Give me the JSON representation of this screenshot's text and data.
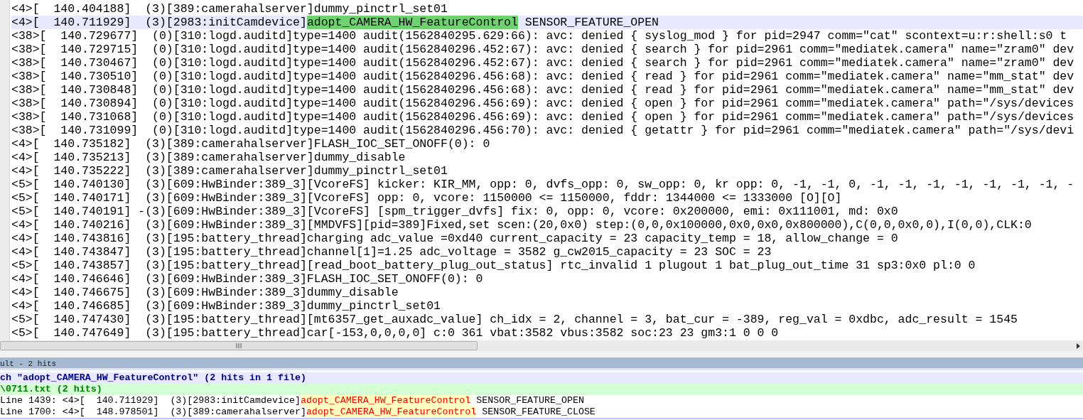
{
  "editor": {
    "lines": [
      {
        "current": false,
        "text": "<4>[  140.404188]  (3)[389:camerahalserver]dummy_pinctrl_set01"
      },
      {
        "current": true,
        "parts": [
          {
            "text": "<4>[  140.711929]  (3)[2983:initCamdevice]",
            "marked": false
          },
          {
            "text": "adopt_CAMERA_HW_FeatureControl",
            "marked": true
          },
          {
            "text": " SENSOR_FEATURE_OPEN",
            "marked": false
          }
        ]
      },
      {
        "current": false,
        "text": "<38>[  140.729677]  (0)[310:logd.auditd]type=1400 audit(1562840295.629:66): avc: denied { syslog_mod } for pid=2947 comm=\"cat\" scontext=u:r:shell:s0 t"
      },
      {
        "current": false,
        "text": "<38>[  140.729715]  (0)[310:logd.auditd]type=1400 audit(1562840296.452:67): avc: denied { search } for pid=2961 comm=\"mediatek.camera\" name=\"zram0\" dev"
      },
      {
        "current": false,
        "text": "<38>[  140.730467]  (0)[310:logd.auditd]type=1400 audit(1562840296.452:67): avc: denied { search } for pid=2961 comm=\"mediatek.camera\" name=\"zram0\" dev"
      },
      {
        "current": false,
        "text": "<38>[  140.730510]  (0)[310:logd.auditd]type=1400 audit(1562840296.456:68): avc: denied { read } for pid=2961 comm=\"mediatek.camera\" name=\"mm_stat\" dev"
      },
      {
        "current": false,
        "text": "<38>[  140.730848]  (0)[310:logd.auditd]type=1400 audit(1562840296.456:68): avc: denied { read } for pid=2961 comm=\"mediatek.camera\" name=\"mm_stat\" dev"
      },
      {
        "current": false,
        "text": "<38>[  140.730894]  (0)[310:logd.auditd]type=1400 audit(1562840296.456:69): avc: denied { open } for pid=2961 comm=\"mediatek.camera\" path=\"/sys/devices"
      },
      {
        "current": false,
        "text": "<38>[  140.731068]  (0)[310:logd.auditd]type=1400 audit(1562840296.456:69): avc: denied { open } for pid=2961 comm=\"mediatek.camera\" path=\"/sys/devices"
      },
      {
        "current": false,
        "text": "<38>[  140.731099]  (0)[310:logd.auditd]type=1400 audit(1562840296.456:70): avc: denied { getattr } for pid=2961 comm=\"mediatek.camera\" path=\"/sys/devi"
      },
      {
        "current": false,
        "text": "<4>[  140.735182]  (3)[389:camerahalserver]FLASH_IOC_SET_ONOFF(0): 0"
      },
      {
        "current": false,
        "text": "<4>[  140.735213]  (3)[389:camerahalserver]dummy_disable"
      },
      {
        "current": false,
        "text": "<4>[  140.735222]  (3)[389:camerahalserver]dummy_pinctrl_set01"
      },
      {
        "current": false,
        "text": "<5>[  140.740130]  (3)[609:HwBinder:389_3][VcoreFS] kicker: KIR_MM, opp: 0, dvfs_opp: 0, sw_opp: 0, kr opp: 0, -1, -1, 0, -1, -1, -1, -1, -1, -1, -1, -"
      },
      {
        "current": false,
        "text": "<5>[  140.740171]  (3)[609:HwBinder:389_3][VcoreFS] opp: 0, vcore: 1150000 <= 1150000, fddr: 1344000 <= 1333000 [O][O]"
      },
      {
        "current": false,
        "text": "<5>[  140.740191] -(3)[609:HwBinder:389_3][VcoreFS] [spm_trigger_dvfs] fix: 0, opp: 0, vcore: 0x200000, emi: 0x111001, md: 0x0"
      },
      {
        "current": false,
        "text": "<4>[  140.740216]  (3)[609:HwBinder:389_3][MMDVFS][pid=389]Fixed,set scen:(20,0x0) step:(0,0,0x100000,0x0,0x0,0x800000),C(0,0,0x0,0),I(0,0),CLK:0"
      },
      {
        "current": false,
        "text": "<4>[  140.743816]  (3)[195:battery_thread]charging adc_value =0xd40 current_capacity = 23 capacity_temp = 18, allow_change = 0"
      },
      {
        "current": false,
        "text": "<4>[  140.743847]  (3)[195:battery_thread]channel[1]=1.25 adc_voltage = 3582 g_cw2015_capacity = 23 SOC = 23"
      },
      {
        "current": false,
        "text": "<5>[  140.743857]  (3)[195:battery_thread][read_boot_battery_plug_out_status] rtc_invalid 1 plugout 1 bat_plug_out_time 31 sp3:0x0 pl:0 0"
      },
      {
        "current": false,
        "text": "<4>[  140.746646]  (3)[609:HwBinder:389_3]FLASH_IOC_SET_ONOFF(0): 0"
      },
      {
        "current": false,
        "text": "<4>[  140.746675]  (3)[609:HwBinder:389_3]dummy_disable"
      },
      {
        "current": false,
        "text": "<4>[  140.746685]  (3)[609:HwBinder:389_3]dummy_pinctrl_set01"
      },
      {
        "current": false,
        "text": "<5>[  140.747430]  (3)[195:battery_thread][mt6357_get_auxadc_value] ch_idx = 2, channel = 3, bat_cur = -389, reg_val = 0xdbc, adc_result = 1545"
      },
      {
        "current": false,
        "text": "<5>[  140.747649]  (3)[195:battery_thread]car[-153,0,0,0,0] c:0 361 vbat:3582 vbus:3582 soc:23 23 gm3:1 0 0 0"
      }
    ]
  },
  "search_panel": {
    "title": "ult - 2 hits",
    "search_header": "ch \"adopt_CAMERA_HW_FeatureControl\" (2 hits in 1 file)",
    "file": "\\0711.txt (2 hits)",
    "results": [
      {
        "parts": [
          {
            "text": "Line 1439: <4>[  140.711929]  (3)[2983:initCamdevice]",
            "marked": false
          },
          {
            "text": "adopt_CAMERA_HW_FeatureControl",
            "marked": true
          },
          {
            "text": " SENSOR_FEATURE_OPEN",
            "marked": false
          }
        ]
      },
      {
        "parts": [
          {
            "text": "Line 1700: <4>[  148.978501]  (3)[389:camerahalserver]",
            "marked": false
          },
          {
            "text": "adopt_CAMERA_HW_FeatureControl",
            "marked": true
          },
          {
            "text": " SENSOR_FEATURE_CLOSE",
            "marked": false
          }
        ]
      }
    ]
  }
}
